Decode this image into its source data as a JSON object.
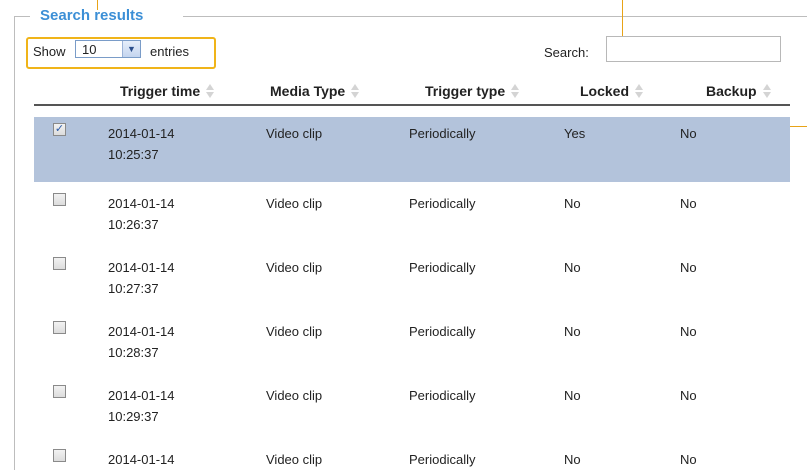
{
  "legend": "Search results",
  "controls": {
    "show_label": "Show",
    "entries_value": "10",
    "entries_label": "entries",
    "search_label": "Search:",
    "search_value": ""
  },
  "columns": [
    "",
    "Trigger time",
    "Media Type",
    "Trigger type",
    "Locked",
    "Backup"
  ],
  "rows": [
    {
      "checked": true,
      "date": "2014-01-14",
      "time": "10:25:37",
      "media": "Video clip",
      "trigger": "Periodically",
      "locked": "Yes",
      "backup": "No"
    },
    {
      "checked": false,
      "date": "2014-01-14",
      "time": "10:26:37",
      "media": "Video clip",
      "trigger": "Periodically",
      "locked": "No",
      "backup": "No"
    },
    {
      "checked": false,
      "date": "2014-01-14",
      "time": "10:27:37",
      "media": "Video clip",
      "trigger": "Periodically",
      "locked": "No",
      "backup": "No"
    },
    {
      "checked": false,
      "date": "2014-01-14",
      "time": "10:28:37",
      "media": "Video clip",
      "trigger": "Periodically",
      "locked": "No",
      "backup": "No"
    },
    {
      "checked": false,
      "date": "2014-01-14",
      "time": "10:29:37",
      "media": "Video clip",
      "trigger": "Periodically",
      "locked": "No",
      "backup": "No"
    },
    {
      "checked": false,
      "date": "2014-01-14",
      "time": "",
      "media": "Video clip",
      "trigger": "Periodically",
      "locked": "No",
      "backup": "No"
    }
  ],
  "colors": {
    "accent": "#3c8fd6",
    "highlight": "#f0b419",
    "selected_row": "#b3c3db"
  }
}
